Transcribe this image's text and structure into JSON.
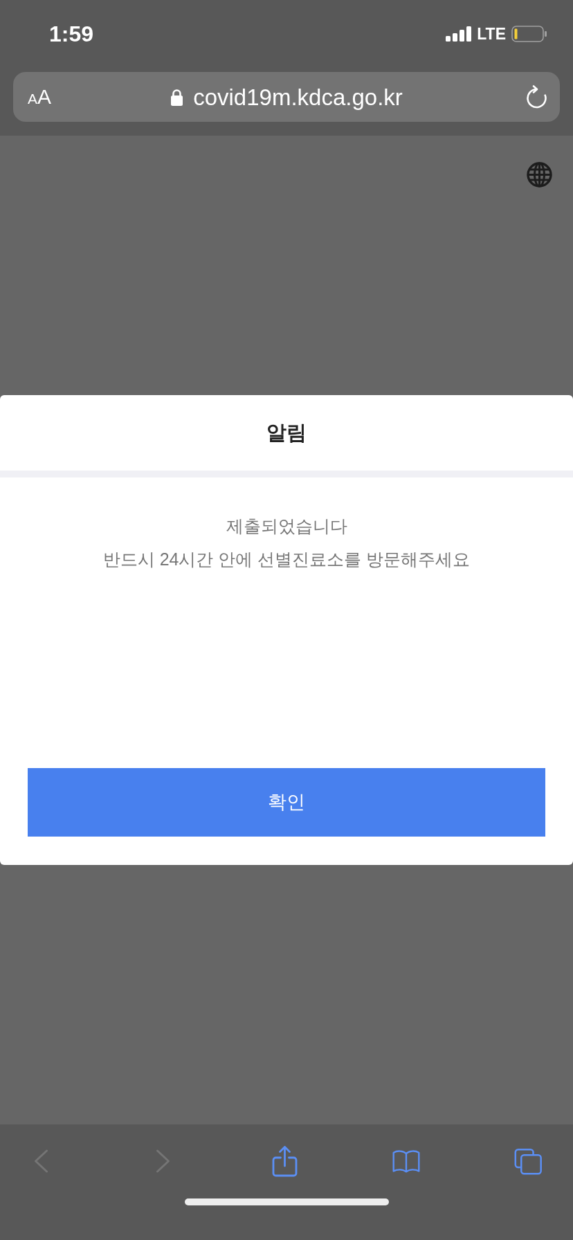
{
  "status_bar": {
    "time": "1:59",
    "network": "LTE"
  },
  "address_bar": {
    "text_size_button": {
      "small": "A",
      "large": "A"
    },
    "secure": true,
    "url": "covid19m.kdca.go.kr"
  },
  "dialog": {
    "title": "알림",
    "message_lines": [
      "제출되었습니다",
      "반드시 24시간 안에 선별진료소를 방문해주세요"
    ],
    "button": "확인"
  },
  "toolbar": [
    {
      "kind": "back",
      "disabled": true
    },
    {
      "kind": "forward",
      "disabled": true
    },
    {
      "kind": "share",
      "disabled": false
    },
    {
      "kind": "bookmarks",
      "disabled": false
    },
    {
      "kind": "tabs",
      "disabled": false
    }
  ]
}
